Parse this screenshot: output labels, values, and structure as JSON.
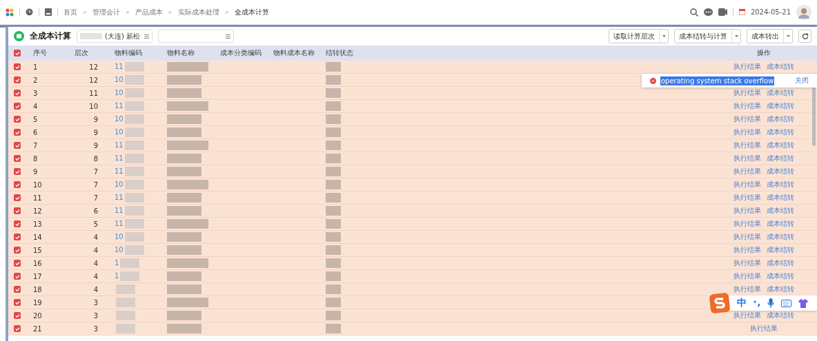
{
  "topbar": {
    "breadcrumbs": [
      "首页",
      "管理会计",
      "产品成本",
      "实际成本处理",
      "全成本计算"
    ],
    "separator": ">",
    "date": "2024-05-21"
  },
  "page": {
    "title": "全成本计算",
    "filter_1": {
      "value": "(大连) 新松"
    },
    "buttons": [
      {
        "label": "读取计算层次"
      },
      {
        "label": "成本结转与计算"
      },
      {
        "label": "成本转出"
      }
    ]
  },
  "table": {
    "all_checked": true,
    "columns": [
      "序号",
      "层次",
      "物料编码",
      "物料名称",
      "成本分类编码",
      "物料成本名称",
      "结转状态",
      "操作"
    ],
    "rows": [
      {
        "index": "1",
        "level": "12",
        "code": "11",
        "checked": true,
        "actions": [
          "执行结果",
          "成本结转"
        ]
      },
      {
        "index": "2",
        "level": "12",
        "code": "10",
        "checked": true
      },
      {
        "index": "3",
        "level": "11",
        "code": "10",
        "checked": true,
        "actions": [
          "执行结果",
          "成本结转"
        ]
      },
      {
        "index": "4",
        "level": "10",
        "code": "11",
        "checked": true,
        "actions": [
          "执行结果",
          "成本结转"
        ]
      },
      {
        "index": "5",
        "level": "9",
        "code": "10",
        "checked": true,
        "actions": [
          "执行结果",
          "成本结转"
        ]
      },
      {
        "index": "6",
        "level": "9",
        "code": "10",
        "checked": true,
        "actions": [
          "执行结果",
          "成本结转"
        ]
      },
      {
        "index": "7",
        "level": "9",
        "code": "11",
        "checked": true,
        "actions": [
          "执行结果",
          "成本结转"
        ]
      },
      {
        "index": "8",
        "level": "8",
        "code": "11",
        "checked": true,
        "actions": [
          "执行结果",
          "成本结转"
        ]
      },
      {
        "index": "9",
        "level": "7",
        "code": "11",
        "checked": true,
        "actions": [
          "执行结果",
          "成本结转"
        ]
      },
      {
        "index": "10",
        "level": "7",
        "code": "10",
        "checked": true,
        "actions": [
          "执行结果",
          "成本结转"
        ]
      },
      {
        "index": "11",
        "level": "7",
        "code": "11",
        "checked": true,
        "actions": [
          "执行结果",
          "成本结转"
        ]
      },
      {
        "index": "12",
        "level": "6",
        "code": "11",
        "checked": true,
        "actions": [
          "执行结果",
          "成本结转"
        ]
      },
      {
        "index": "13",
        "level": "5",
        "code": "11",
        "checked": true,
        "actions": [
          "执行结果",
          "成本结转"
        ]
      },
      {
        "index": "14",
        "level": "4",
        "code": "10",
        "checked": true,
        "actions": [
          "执行结果",
          "成本结转"
        ]
      },
      {
        "index": "15",
        "level": "4",
        "code": "10",
        "checked": true,
        "actions": [
          "执行结果",
          "成本结转"
        ]
      },
      {
        "index": "16",
        "level": "4",
        "code": "1",
        "checked": true,
        "actions": [
          "执行结果",
          "成本结转"
        ]
      },
      {
        "index": "17",
        "level": "4",
        "code": "1",
        "checked": true,
        "actions": [
          "执行结果",
          "成本结转"
        ]
      },
      {
        "index": "18",
        "level": "4",
        "checked": true,
        "actions": [
          "执行结果",
          "成本结转"
        ]
      },
      {
        "index": "19",
        "level": "3",
        "checked": true
      },
      {
        "index": "20",
        "level": "3",
        "checked": true,
        "actions": [
          "执行结果",
          "成本结转"
        ]
      },
      {
        "index": "21",
        "level": "3",
        "checked": true,
        "actions": [
          "执行结果"
        ]
      }
    ]
  },
  "error_toast": {
    "message": "operating system stack overflow",
    "close": "关闭"
  },
  "ime_toolbar": {
    "mode": "中"
  }
}
